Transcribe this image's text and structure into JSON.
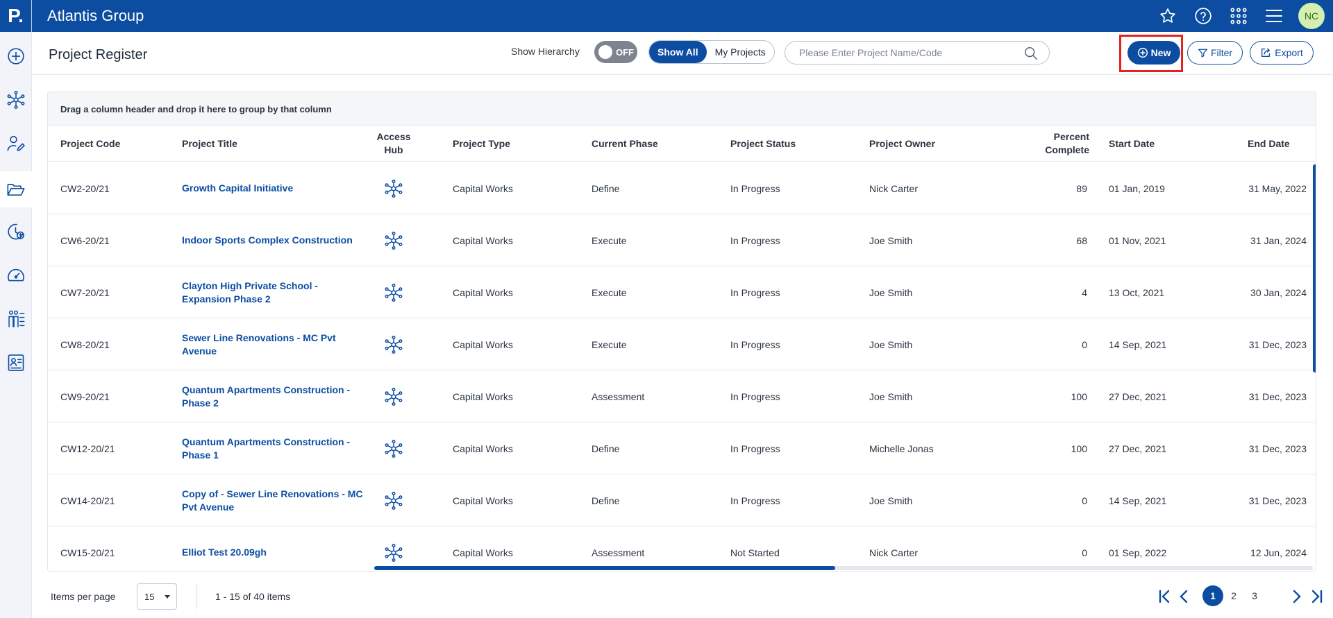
{
  "app": {
    "logo": "P.",
    "title": "Atlantis Group"
  },
  "topbar_icons": [
    "star-icon",
    "help-icon",
    "apps-grid-icon",
    "menu-icon"
  ],
  "user": {
    "initials": "NC"
  },
  "sidebar_icons": [
    "add-icon",
    "hub-network-icon",
    "edit-user-icon",
    "folder-icon",
    "cost-clock-icon",
    "dashboard-gauge-icon",
    "people-list-icon",
    "contact-card-icon"
  ],
  "page": {
    "title": "Project Register",
    "show_hierarchy_label": "Show Hierarchy",
    "toggle_state": "OFF",
    "filter_tabs": [
      "Show All",
      "My Projects"
    ],
    "search_placeholder": "Please Enter Project Name/Code",
    "new_label": "New",
    "filter_label": "Filter",
    "export_label": "Export"
  },
  "grid": {
    "group_hint": "Drag a column header and drop it here to group by that column",
    "columns": {
      "code": "Project Code",
      "title": "Project Title",
      "hub_line1": "Access",
      "hub_line2": "Hub",
      "type": "Project Type",
      "phase": "Current Phase",
      "status": "Project Status",
      "owner": "Project Owner",
      "pct_line1": "Percent",
      "pct_line2": "Complete",
      "start": "Start Date",
      "end": "End Date"
    },
    "rows": [
      {
        "code": "CW2-20/21",
        "title_line1": "Growth Capital Initiative",
        "title_line2": "",
        "type": "Capital Works",
        "phase": "Define",
        "status": "In Progress",
        "owner": "Nick Carter",
        "percent": "89",
        "start": "01 Jan, 2019",
        "end": "31 May, 2022"
      },
      {
        "code": "CW6-20/21",
        "title_line1": "Indoor Sports Complex Construction",
        "title_line2": "",
        "type": "Capital Works",
        "phase": "Execute",
        "status": "In Progress",
        "owner": "Joe Smith",
        "percent": "68",
        "start": "01 Nov, 2021",
        "end": "31 Jan, 2024"
      },
      {
        "code": "CW7-20/21",
        "title_line1": "Clayton High Private School -",
        "title_line2": "Expansion Phase 2",
        "type": "Capital Works",
        "phase": "Execute",
        "status": "In Progress",
        "owner": "Joe Smith",
        "percent": "4",
        "start": "13 Oct, 2021",
        "end": "30 Jan, 2024"
      },
      {
        "code": "CW8-20/21",
        "title_line1": "Sewer Line Renovations - MC Pvt",
        "title_line2": "Avenue",
        "type": "Capital Works",
        "phase": "Execute",
        "status": "In Progress",
        "owner": "Joe Smith",
        "percent": "0",
        "start": "14 Sep, 2021",
        "end": "31 Dec, 2023"
      },
      {
        "code": "CW9-20/21",
        "title_line1": "Quantum Apartments Construction -",
        "title_line2": "Phase 2",
        "type": "Capital Works",
        "phase": "Assessment",
        "status": "In Progress",
        "owner": "Joe Smith",
        "percent": "100",
        "start": "27 Dec, 2021",
        "end": "31 Dec, 2023"
      },
      {
        "code": "CW12-20/21",
        "title_line1": "Quantum Apartments Construction -",
        "title_line2": "Phase 1",
        "type": "Capital Works",
        "phase": "Define",
        "status": "In Progress",
        "owner": "Michelle Jonas",
        "percent": "100",
        "start": "27 Dec, 2021",
        "end": "31 Dec, 2023"
      },
      {
        "code": "CW14-20/21",
        "title_line1": "Copy of - Sewer Line Renovations - MC",
        "title_line2": "Pvt Avenue",
        "type": "Capital Works",
        "phase": "Define",
        "status": "In Progress",
        "owner": "Joe Smith",
        "percent": "0",
        "start": "14 Sep, 2021",
        "end": "31 Dec, 2023"
      },
      {
        "code": "CW15-20/21",
        "title_line1": "Elliot Test 20.09gh",
        "title_line2": "",
        "type": "Capital Works",
        "phase": "Assessment",
        "status": "Not Started",
        "owner": "Nick Carter",
        "percent": "0",
        "start": "01 Sep, 2022",
        "end": "12 Jun, 2024"
      }
    ]
  },
  "pagination": {
    "items_per_page_label": "Items per page",
    "items_per_page_value": "15",
    "range_text": "1 - 15 of 40 items",
    "pages": [
      "1",
      "2",
      "3"
    ],
    "current_page": "1"
  },
  "colors": {
    "brand": "#0c4da2",
    "highlight": "#e8201f",
    "avatar_bg": "#d5efb0"
  }
}
